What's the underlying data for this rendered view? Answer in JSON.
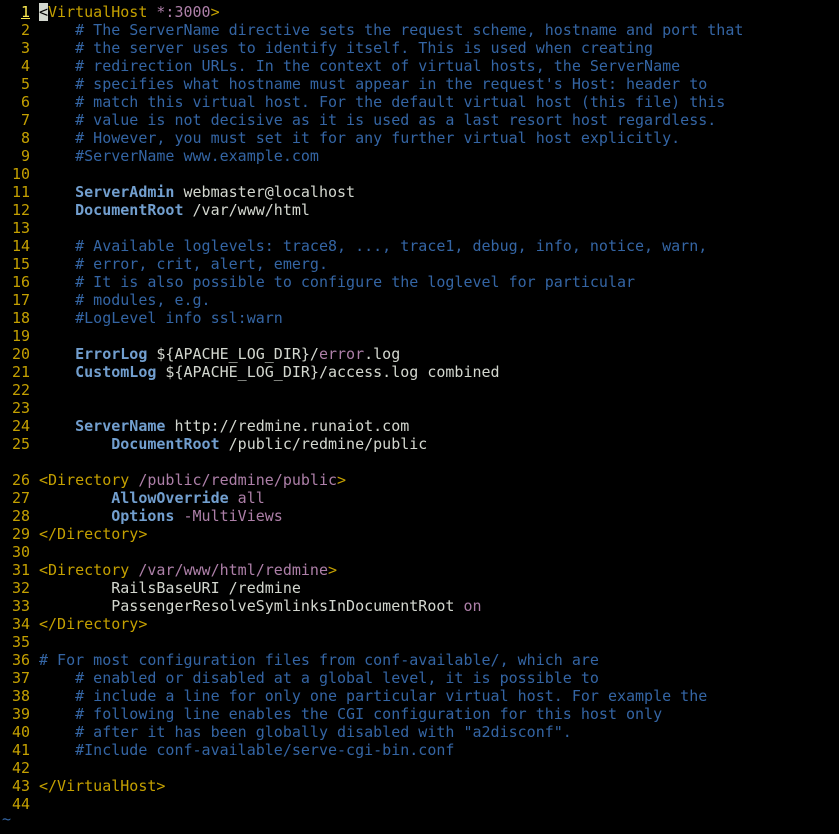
{
  "editor": {
    "colors": {
      "background": "#000000",
      "line_number": "#c4a000",
      "line_number_current": "#fce94f",
      "comment": "#3465a4",
      "tag": "#c4a000",
      "path": "#ad7fa8",
      "keyword": "#729fcf",
      "text": "#d3d7cf",
      "empty_line_marker": "#3465a4"
    },
    "empty_line_marker": "~",
    "lines": [
      {
        "n": "1",
        "cursor": true,
        "segs": [
          {
            "t": "<",
            "c": "tag"
          },
          {
            "t": "VirtualHost",
            "c": "tag"
          },
          {
            "t": " *:3000",
            "c": "path"
          },
          {
            "t": ">",
            "c": "tag"
          }
        ]
      },
      {
        "n": "2",
        "segs": [
          {
            "t": "    # The ServerName directive sets the request scheme, hostname and port that",
            "c": "comment"
          }
        ]
      },
      {
        "n": "3",
        "segs": [
          {
            "t": "    # the server uses to identify itself. This is used when creating",
            "c": "comment"
          }
        ]
      },
      {
        "n": "4",
        "segs": [
          {
            "t": "    # redirection URLs. In the context of virtual hosts, the ServerName",
            "c": "comment"
          }
        ]
      },
      {
        "n": "5",
        "segs": [
          {
            "t": "    # specifies what hostname must appear in the request's Host: header to",
            "c": "comment"
          }
        ]
      },
      {
        "n": "6",
        "segs": [
          {
            "t": "    # match this virtual host. For the default virtual host (this file) this",
            "c": "comment"
          }
        ]
      },
      {
        "n": "7",
        "segs": [
          {
            "t": "    # value is not decisive as it is used as a last resort host regardless.",
            "c": "comment"
          }
        ]
      },
      {
        "n": "8",
        "segs": [
          {
            "t": "    # However, you must set it for any further virtual host explicitly.",
            "c": "comment"
          }
        ]
      },
      {
        "n": "9",
        "segs": [
          {
            "t": "    #ServerName www.example.com",
            "c": "comment"
          }
        ]
      },
      {
        "n": "10",
        "segs": []
      },
      {
        "n": "11",
        "segs": [
          {
            "t": "    ",
            "c": "text"
          },
          {
            "t": "ServerAdmin",
            "c": "keyword",
            "b": true
          },
          {
            "t": " webmaster@localhost",
            "c": "text"
          }
        ]
      },
      {
        "n": "12",
        "segs": [
          {
            "t": "    ",
            "c": "text"
          },
          {
            "t": "DocumentRoot",
            "c": "keyword",
            "b": true
          },
          {
            "t": " /var/www/html",
            "c": "text"
          }
        ]
      },
      {
        "n": "13",
        "segs": []
      },
      {
        "n": "14",
        "segs": [
          {
            "t": "    # Available loglevels: trace8, ..., trace1, debug, info, notice, warn,",
            "c": "comment"
          }
        ]
      },
      {
        "n": "15",
        "segs": [
          {
            "t": "    # error, crit, alert, emerg.",
            "c": "comment"
          }
        ]
      },
      {
        "n": "16",
        "segs": [
          {
            "t": "    # It is also possible to configure the loglevel for particular",
            "c": "comment"
          }
        ]
      },
      {
        "n": "17",
        "segs": [
          {
            "t": "    # modules, e.g.",
            "c": "comment"
          }
        ]
      },
      {
        "n": "18",
        "segs": [
          {
            "t": "    #LogLevel info ssl:warn",
            "c": "comment"
          }
        ]
      },
      {
        "n": "19",
        "segs": []
      },
      {
        "n": "20",
        "segs": [
          {
            "t": "    ",
            "c": "text"
          },
          {
            "t": "ErrorLog",
            "c": "keyword",
            "b": true
          },
          {
            "t": " ${APACHE_LOG_DIR}/",
            "c": "text"
          },
          {
            "t": "error",
            "c": "path"
          },
          {
            "t": ".log",
            "c": "text"
          }
        ]
      },
      {
        "n": "21",
        "segs": [
          {
            "t": "    ",
            "c": "text"
          },
          {
            "t": "CustomLog",
            "c": "keyword",
            "b": true
          },
          {
            "t": " ${APACHE_LOG_DIR}/access.log combined",
            "c": "text"
          }
        ]
      },
      {
        "n": "22",
        "segs": []
      },
      {
        "n": "23",
        "segs": []
      },
      {
        "n": "24",
        "segs": [
          {
            "t": "    ",
            "c": "text"
          },
          {
            "t": "ServerName",
            "c": "keyword",
            "b": true
          },
          {
            "t": " http://redmine.runaiot.com",
            "c": "text"
          }
        ]
      },
      {
        "n": "25",
        "segs": [
          {
            "t": "        ",
            "c": "text"
          },
          {
            "t": "DocumentRoot",
            "c": "keyword",
            "b": true
          },
          {
            "t": " /public/redmine/public",
            "c": "text"
          }
        ]
      },
      {
        "n": "",
        "segs": []
      },
      {
        "n": "26",
        "segs": [
          {
            "t": "<Directory",
            "c": "tag"
          },
          {
            "t": " /public/redmine/public",
            "c": "path"
          },
          {
            "t": ">",
            "c": "tag"
          }
        ]
      },
      {
        "n": "27",
        "segs": [
          {
            "t": "        ",
            "c": "text"
          },
          {
            "t": "AllowOverride",
            "c": "keyword",
            "b": true
          },
          {
            "t": " all",
            "c": "path"
          }
        ]
      },
      {
        "n": "28",
        "segs": [
          {
            "t": "        ",
            "c": "text"
          },
          {
            "t": "Options",
            "c": "keyword",
            "b": true
          },
          {
            "t": " -MultiViews",
            "c": "path"
          }
        ]
      },
      {
        "n": "29",
        "segs": [
          {
            "t": "</Directory>",
            "c": "tag"
          }
        ]
      },
      {
        "n": "30",
        "segs": []
      },
      {
        "n": "31",
        "segs": [
          {
            "t": "<Directory",
            "c": "tag"
          },
          {
            "t": " /var/www/html/redmine",
            "c": "path"
          },
          {
            "t": ">",
            "c": "tag"
          }
        ]
      },
      {
        "n": "32",
        "segs": [
          {
            "t": "        RailsBaseURI /redmine",
            "c": "text"
          }
        ]
      },
      {
        "n": "33",
        "segs": [
          {
            "t": "        PassengerResolveSymlinksInDocumentRoot ",
            "c": "text"
          },
          {
            "t": "on",
            "c": "path"
          }
        ]
      },
      {
        "n": "34",
        "segs": [
          {
            "t": "</Directory>",
            "c": "tag"
          }
        ]
      },
      {
        "n": "35",
        "segs": []
      },
      {
        "n": "36",
        "segs": [
          {
            "t": "# For most configuration files from conf-available/, which are",
            "c": "comment"
          }
        ]
      },
      {
        "n": "37",
        "segs": [
          {
            "t": "    # enabled or disabled at a global level, it is possible to",
            "c": "comment"
          }
        ]
      },
      {
        "n": "38",
        "segs": [
          {
            "t": "    # include a line for only one particular virtual host. For example the",
            "c": "comment"
          }
        ]
      },
      {
        "n": "39",
        "segs": [
          {
            "t": "    # following line enables the CGI configuration for this host only",
            "c": "comment"
          }
        ]
      },
      {
        "n": "40",
        "segs": [
          {
            "t": "    # after it has been globally disabled with \"a2disconf\".",
            "c": "comment"
          }
        ]
      },
      {
        "n": "41",
        "segs": [
          {
            "t": "    #Include conf-available/serve-cgi-bin.conf",
            "c": "comment"
          }
        ]
      },
      {
        "n": "42",
        "segs": []
      },
      {
        "n": "43",
        "segs": [
          {
            "t": "</VirtualHost>",
            "c": "tag"
          }
        ]
      },
      {
        "n": "44",
        "segs": []
      }
    ]
  }
}
